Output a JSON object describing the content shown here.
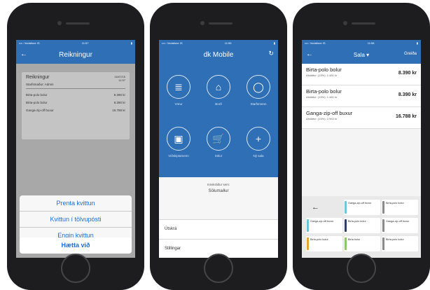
{
  "status": {
    "carrier": "•••○ Vodafone IS",
    "time": "11:57",
    "time2": "11:55",
    "time3": "11:58"
  },
  "phone1": {
    "title": "Reikningur",
    "card": {
      "title": "Reikningur",
      "date": "16/07/15",
      "time": "11:57",
      "staff": "Starfsmaður: Admin",
      "rows": [
        {
          "name": "Birta-polo bolur",
          "price": "8.390 kr"
        },
        {
          "name": "Birta-polo bolur",
          "price": "8.390 kr"
        },
        {
          "name": "Ganga-zip-off buxur",
          "price": "16.788 kr"
        }
      ]
    },
    "sheet": [
      "Prenta kvittun",
      "Kvittun í tölvupósti",
      "Engin kvittun"
    ],
    "cancel": "Hætta við"
  },
  "phone2": {
    "title": "dk Mobile",
    "tiles": [
      {
        "label": "Vörur",
        "icon": "≣"
      },
      {
        "label": "Borð",
        "icon": "⌂"
      },
      {
        "label": "Starfsmenn",
        "icon": "◯"
      },
      {
        "label": "Viðskiptamenn",
        "icon": "▣"
      },
      {
        "label": "Sölur",
        "icon": "🛒"
      },
      {
        "label": "Ný sala",
        "icon": "+"
      }
    ],
    "employee_label": "Innskráður sem:",
    "employee_name": "Sölumaður",
    "menu": [
      "Útskrá",
      "Stillingar"
    ]
  },
  "phone3": {
    "title": "Sala ▾",
    "right": "Greiða",
    "items": [
      {
        "name": "Birta-polo bolur",
        "discount": "Afsláttur: (15%): 1.481 kr",
        "price": "8.390 kr"
      },
      {
        "name": "Birta-polo bolur",
        "discount": "Afsláttur: (15%): 1.481 kr",
        "price": "8.390 kr"
      },
      {
        "name": "Ganga-zip-off buxur",
        "discount": "Afsláttur: (15%): 2.963 kr",
        "price": "16.788 kr"
      }
    ],
    "keypad": [
      {
        "label": "Ganga-zip-off buxur",
        "color": "#6cc5d8"
      },
      {
        "label": "Birta-polo bolur",
        "color": "#8a8a8a"
      },
      {
        "label": "Ganga-zip-off buxur",
        "color": "#6cc5d8"
      },
      {
        "label": "Birta-polo bolur",
        "color": "#2d3f66"
      },
      {
        "label": "Ganga-zip-off buxur",
        "color": "#8a8a8a"
      },
      {
        "label": "Birta-polo bolur",
        "color": "#e3a63a"
      },
      {
        "label": "Birta bolur",
        "color": "#8ac66a"
      },
      {
        "label": "Birta-polo bolur",
        "color": "#8a8a8a"
      }
    ]
  },
  "colors": {
    "accent": "#2f6fb6",
    "link": "#1a6ed8"
  }
}
